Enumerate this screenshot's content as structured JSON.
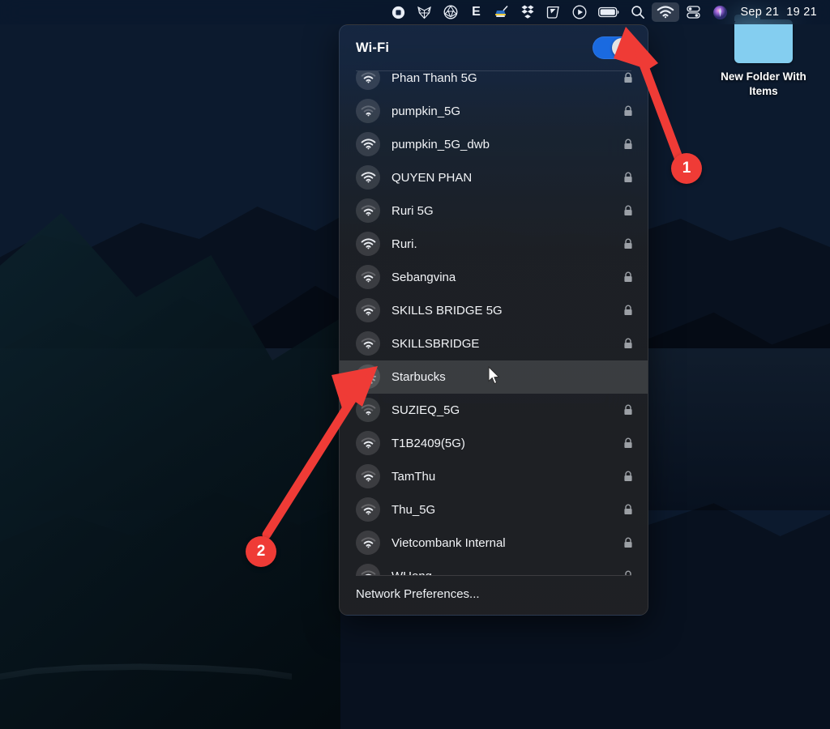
{
  "menubar": {
    "icons": [
      {
        "name": "record-stop-icon",
        "glyph": "record-stop"
      },
      {
        "name": "fox-app-icon",
        "glyph": "fox"
      },
      {
        "name": "aperture-icon",
        "glyph": "aperture"
      },
      {
        "name": "evernote-icon",
        "glyph": "E",
        "label": "E"
      },
      {
        "name": "ukraine-app-icon",
        "glyph": "flag-app"
      },
      {
        "name": "dropbox-icon",
        "glyph": "dropbox"
      },
      {
        "name": "shape-app-icon",
        "glyph": "shape"
      },
      {
        "name": "play-circle-icon",
        "glyph": "play-circle"
      },
      {
        "name": "battery-icon",
        "glyph": "battery"
      },
      {
        "name": "spotlight-search-icon",
        "glyph": "search"
      },
      {
        "name": "wifi-menubar-icon",
        "glyph": "wifi",
        "active": true
      },
      {
        "name": "control-center-icon",
        "glyph": "control-center"
      },
      {
        "name": "siri-icon",
        "glyph": "siri"
      }
    ],
    "clock": {
      "date": "Sep 21",
      "time": "19 21"
    }
  },
  "desktop": {
    "folder": {
      "label": "New Folder With Items",
      "icon_color": "#84cef0"
    }
  },
  "wifi_panel": {
    "title": "Wi-Fi",
    "toggle": {
      "state": "on",
      "accent_color": "#1a6ae0",
      "knob_color": "#e3e3e3"
    },
    "networks": [
      {
        "name": "Phan Thanh 5G",
        "secured": true,
        "bars": 2,
        "status": "idle",
        "clipped_top": true
      },
      {
        "name": "pumpkin_5G",
        "secured": true,
        "bars": 1,
        "status": "idle"
      },
      {
        "name": "pumpkin_5G_dwb",
        "secured": true,
        "bars": 3,
        "status": "idle"
      },
      {
        "name": "QUYEN PHAN",
        "secured": true,
        "bars": 3,
        "status": "idle"
      },
      {
        "name": "Ruri 5G",
        "secured": true,
        "bars": 2,
        "status": "idle"
      },
      {
        "name": "Ruri.",
        "secured": true,
        "bars": 3,
        "status": "idle"
      },
      {
        "name": "Sebangvina",
        "secured": true,
        "bars": 2,
        "status": "idle"
      },
      {
        "name": "SKILLS BRIDGE 5G",
        "secured": true,
        "bars": 2,
        "status": "idle"
      },
      {
        "name": "SKILLSBRIDGE",
        "secured": true,
        "bars": 2,
        "status": "idle"
      },
      {
        "name": "Starbucks",
        "secured": false,
        "bars": 0,
        "status": "connecting",
        "selected": true
      },
      {
        "name": "SUZIEQ_5G",
        "secured": true,
        "bars": 1,
        "status": "idle"
      },
      {
        "name": "T1B2409(5G)",
        "secured": true,
        "bars": 2,
        "status": "idle"
      },
      {
        "name": "TamThu",
        "secured": true,
        "bars": 2,
        "status": "idle"
      },
      {
        "name": "Thu_5G",
        "secured": true,
        "bars": 2,
        "status": "idle"
      },
      {
        "name": "Vietcombank Internal",
        "secured": true,
        "bars": 2,
        "status": "idle"
      },
      {
        "name": "WHong",
        "secured": true,
        "bars": 2,
        "status": "idle",
        "clipped_bottom": true
      }
    ],
    "footer": {
      "network_preferences_label": "Network Preferences..."
    }
  },
  "annotations": {
    "color": "#ef3b36",
    "markers": [
      {
        "label": "1",
        "target": "wifi-menubar-icon"
      },
      {
        "label": "2",
        "target": "network-row-starbucks"
      }
    ]
  }
}
